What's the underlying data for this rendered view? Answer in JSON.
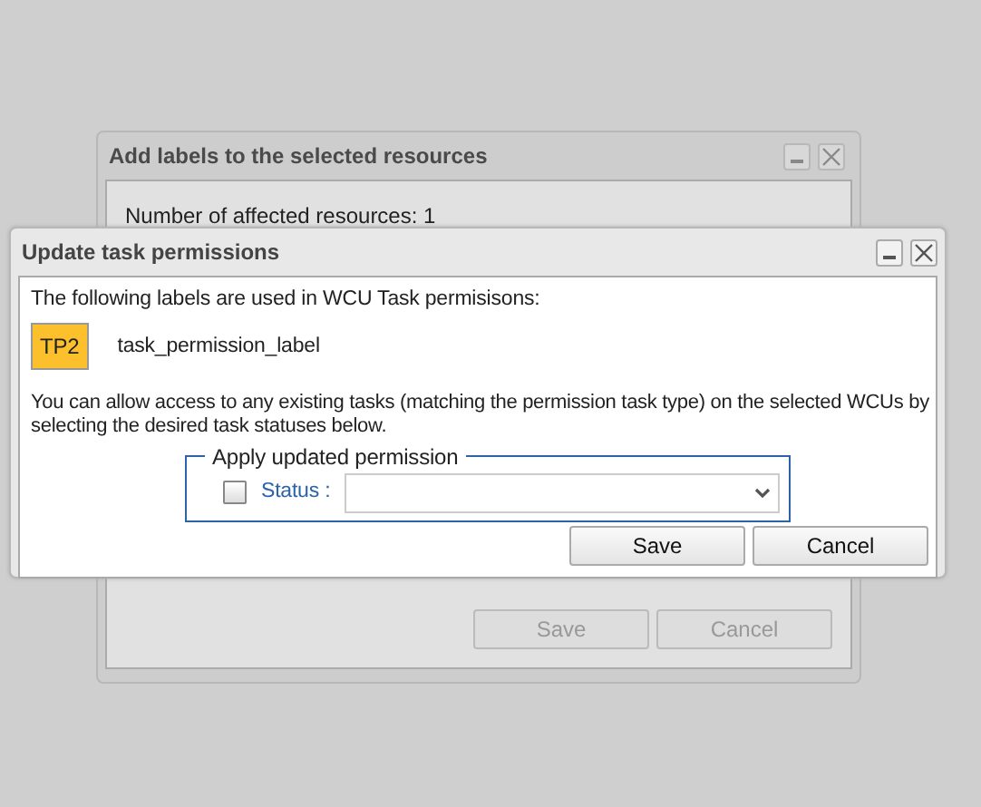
{
  "back_window": {
    "title": "Add labels to the selected resources",
    "text": "Number of affected resources: 1",
    "buttons": [
      {
        "label": "Save",
        "disabled": true
      },
      {
        "label": "Cancel",
        "disabled": true
      }
    ]
  },
  "window": {
    "title": "Update task permissions",
    "intro": "The following labels are used in WCU Task permisisons:",
    "labels": [
      {
        "tag": "TP2",
        "name": "task_permission_label",
        "color": "#fcc02c"
      }
    ],
    "description": "You can allow access to any existing tasks (matching the permission task type) on the selected WCUs by selecting the desired task statuses below.",
    "fieldset": {
      "legend": "Apply updated permission",
      "status": {
        "label": "Status :",
        "checked": false
      }
    },
    "buttons": [
      {
        "label": "Save",
        "disabled": false
      },
      {
        "label": "Cancel",
        "disabled": false
      }
    ]
  }
}
